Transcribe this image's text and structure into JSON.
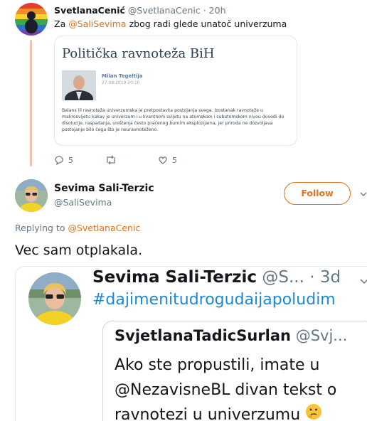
{
  "parent_tweet": {
    "author_name": "SvetlanaCenić",
    "author_handle": "@SvetlanaCenic",
    "separator": "·",
    "time": "20h",
    "text_prefix": "Za",
    "mention": "@SaliSevima",
    "text_suffix": "zbog radi glede unatoč univerzuma",
    "card": {
      "title": "Politička ravnoteža BiH",
      "author": "Milan Tegeltija",
      "date": "27.08.2019 20:10",
      "excerpt": "Balans ili ravnoteža univerzumska je pretpostavka postojanja svega. Izostanak ravnoteže u makrosvijetu kakav je univerzum i u kvantnom svijetu na atomskom i subatomskom nivou dovodi do disolucije, raspadanja, uništenja često praćenog burnim eksplozijama, jer priroda ne dozvoljava postojanje bilo čega što je neuravnoteženo."
    },
    "actions": {
      "reply_count": "5",
      "retweet_count": "",
      "like_count": "5"
    }
  },
  "reply_tweet": {
    "author_name": "Sevima Sali-Terzic",
    "author_handle": "@SaliSevima",
    "follow_label": "Follow",
    "replying_prefix": "Replying to",
    "replying_to": "@SvetlanaCenic",
    "text": "Vec sam otplakala."
  },
  "embedded_screenshot": {
    "author_name": "Sevima Sali-Terzic",
    "author_handle_truncated": "@S...",
    "separator": "·",
    "time": "3d",
    "hashtag": "#dajimenitudrogudaijapoludim",
    "quoted": {
      "author_name": "SvjetlanaTadicSurlan",
      "author_handle_truncated": "@Svj...",
      "line1": "Ako ste propustili, imate u",
      "line2": "@NezavisneBL divan tekst o",
      "line3": "ravnotezi u univerzumu"
    }
  },
  "colors": {
    "accent": "#e0731c",
    "hashtag": "#1b8ad3",
    "secondary_text": "#657786",
    "thread_line": "#f4c2aa",
    "border": "#e1e8ed"
  },
  "icons": {
    "reply": "speech-bubble-icon",
    "retweet": "retweet-arrows-icon",
    "like": "heart-icon",
    "menu": "chevron-down-icon",
    "emoji": "thinking-face-emoji"
  }
}
